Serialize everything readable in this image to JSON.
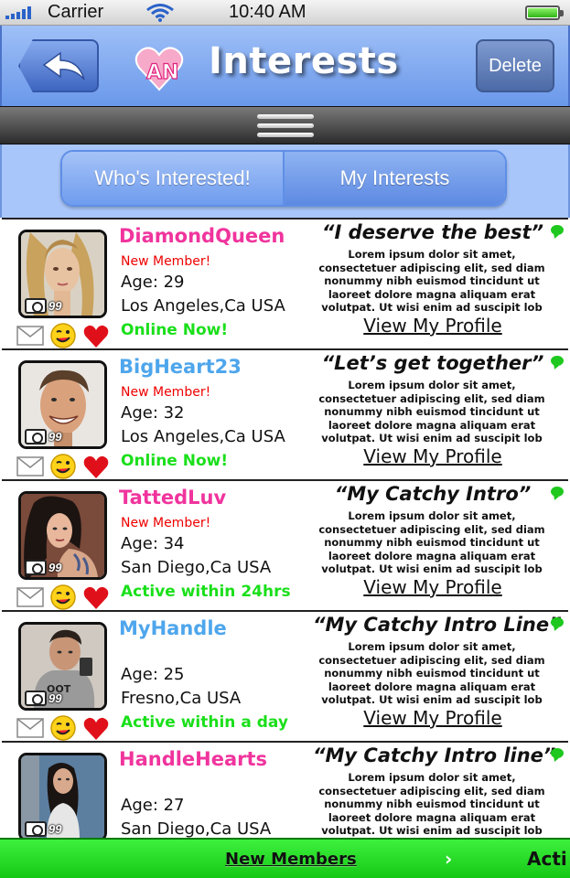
{
  "status_bar": {
    "carrier": "Carrier",
    "time": "10:40 AM"
  },
  "header": {
    "title": "Interests",
    "delete_label": "Delete",
    "logo_text": "AN"
  },
  "segmented": {
    "tabs": [
      "Who's Interested!",
      "My Interests"
    ]
  },
  "profiles": [
    {
      "username": "DiamondQueen",
      "username_color": "#f0349d",
      "new_member": "New Member!",
      "age": "Age: 29",
      "location": "Los Angeles,Ca USA",
      "status": "Online Now!",
      "photo_count": "99",
      "intro": "“I deserve the best”",
      "description": "Lorem ipsum dolor sit amet, consectetuer adipiscing elit, sed diam nonummy nibh euismod tincidunt ut laoreet dolore magna aliquam erat volutpat. Ut wisi enim ad suscipit lob",
      "link": "View My Profile"
    },
    {
      "username": "BigHeart23",
      "username_color": "#4ea6ec",
      "new_member": "New Member!",
      "age": "Age: 32",
      "location": "Los Angeles,Ca USA",
      "status": "Online Now!",
      "photo_count": "99",
      "intro": "“Let’s get together”",
      "description": "Lorem ipsum dolor sit amet, consectetuer adipiscing elit, sed diam nonummy nibh euismod tincidunt ut laoreet dolore magna aliquam erat volutpat. Ut wisi enim ad suscipit lob",
      "link": "View My Profile"
    },
    {
      "username": "TattedLuv",
      "username_color": "#f0349d",
      "new_member": "New Member!",
      "age": "Age: 34",
      "location": "San Diego,Ca USA",
      "status": "Active within 24hrs",
      "photo_count": "99",
      "intro": "“My Catchy Intro”",
      "description": "Lorem ipsum dolor sit amet, consectetuer adipiscing elit, sed diam nonummy nibh euismod tincidunt ut laoreet dolore magna aliquam erat volutpat. Ut wisi enim ad suscipit lob",
      "link": "View My Profile"
    },
    {
      "username": "MyHandle",
      "username_color": "#4ea6ec",
      "new_member": "",
      "age": "Age: 25",
      "location": "Fresno,Ca USA",
      "status": "Active within a day",
      "photo_count": "99",
      "intro": "“My Catchy Intro Line”",
      "description": "Lorem ipsum dolor sit amet, consectetuer adipiscing elit, sed diam nonummy nibh euismod tincidunt ut laoreet dolore magna aliquam erat volutpat. Ut wisi enim ad suscipit lob",
      "link": "View My Profile"
    },
    {
      "username": "HandleHearts",
      "username_color": "#f0349d",
      "new_member": "",
      "age": "Age: 27",
      "location": "San Diego,Ca USA",
      "status": "",
      "photo_count": "99",
      "intro": "“My Catchy Intro line”",
      "description": "Lorem ipsum dolor sit amet, consectetuer adipiscing elit, sed diam nonummy nibh euismod tincidunt ut laoreet dolore magna aliquam erat volutpat. Ut wisi enim ad suscipit lob",
      "link": ""
    }
  ],
  "bottom_bar": {
    "new_members": "New Members",
    "active": "Acti"
  },
  "icons": {
    "back": "back-arrow-icon",
    "menu": "hamburger-menu-icon",
    "camera": "camera-icon",
    "mail": "mail-icon",
    "wink": "wink-emoji-icon",
    "heart": "heart-icon",
    "chat": "chat-bubble-icon",
    "chevron": "chevron-right-icon"
  },
  "colors": {
    "header": "#6a98ea",
    "online": "#1adf1a",
    "new_member": "#ee0000",
    "bottom_bar": "#16c816",
    "pink": "#f0349d",
    "blue": "#4ea6ec"
  }
}
